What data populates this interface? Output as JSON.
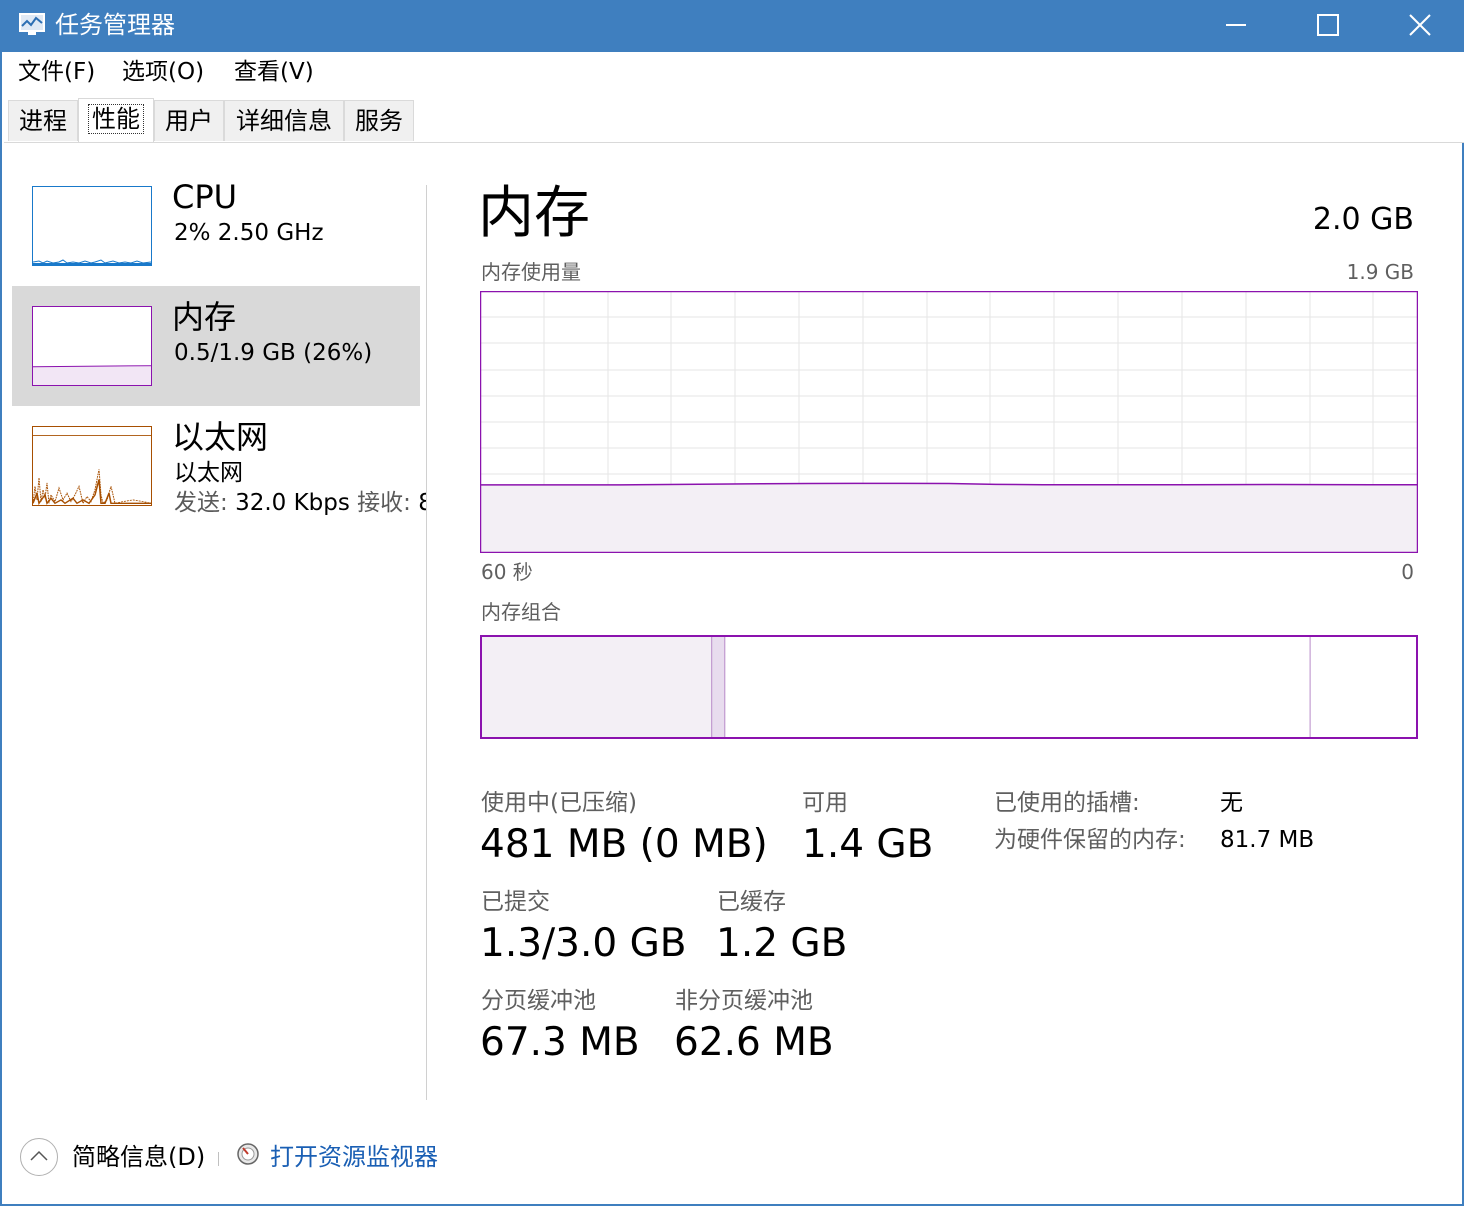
{
  "window": {
    "title": "任务管理器",
    "titlebar_color": "#3f7fbf"
  },
  "menu": [
    "文件(F)",
    "选项(O)",
    "查看(V)"
  ],
  "tabs": [
    {
      "label": "进程",
      "active": false
    },
    {
      "label": "性能",
      "active": true
    },
    {
      "label": "用户",
      "active": false
    },
    {
      "label": "详细信息",
      "active": false
    },
    {
      "label": "服务",
      "active": false
    }
  ],
  "sidebar": {
    "cpu": {
      "title": "CPU",
      "subtitle": "2% 2.50 GHz",
      "color": "#1979ca"
    },
    "memory": {
      "title": "内存",
      "subtitle": "0.5/1.9 GB (26%)",
      "color": "#8b12ae",
      "usage_fraction": 0.26
    },
    "ethernet": {
      "title": "以太网",
      "subtitle": "以太网",
      "send_label": "发送:",
      "send_value": "32.0 Kbps",
      "recv_label": "接收:",
      "recv_value": "8",
      "color": "#a74f01"
    }
  },
  "main": {
    "title": "内存",
    "total": "2.0 GB",
    "usage_label": "内存使用量",
    "usage_max": "1.9 GB",
    "axis_left": "60 秒",
    "axis_right": "0",
    "usage_fraction": 0.26,
    "composition_label": "内存组合",
    "composition": {
      "in_use_fraction": 0.247,
      "modified_fraction": 0.014,
      "standby_fraction": 0.624,
      "free_fraction": 0.115
    }
  },
  "stats": {
    "in_use_label": "使用中(已压缩)",
    "in_use_value": "481 MB (0 MB)",
    "available_label": "可用",
    "available_value": "1.4 GB",
    "committed_label": "已提交",
    "committed_value": "1.3/3.0 GB",
    "cached_label": "已缓存",
    "cached_value": "1.2 GB",
    "paged_label": "分页缓冲池",
    "paged_value": "67.3 MB",
    "nonpaged_label": "非分页缓冲池",
    "nonpaged_value": "62.6 MB",
    "slots_label": "已使用的插槽:",
    "slots_value": "无",
    "reserved_label": "为硬件保留的内存:",
    "reserved_value": "81.7 MB"
  },
  "footer": {
    "fewer_details": "简略信息(D)",
    "open_monitor": "打开资源监视器"
  }
}
